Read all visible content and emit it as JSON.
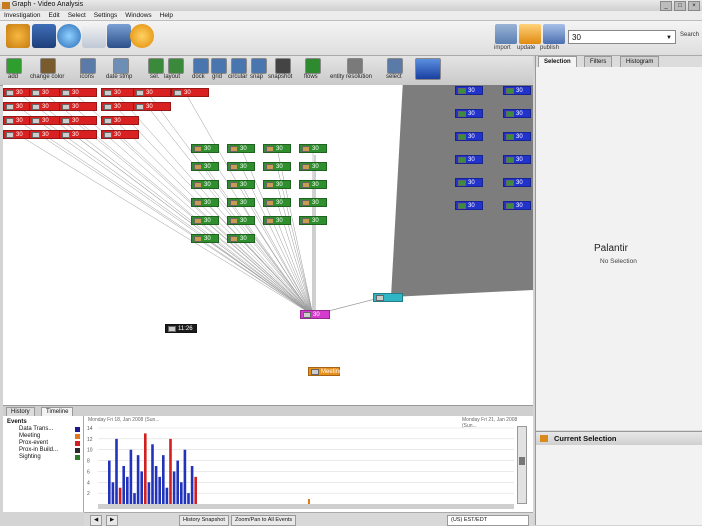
{
  "window": {
    "title": "Graph - Video Analysis"
  },
  "menu": [
    "Investigation",
    "Edit",
    "Select",
    "Settings",
    "Windows",
    "Help"
  ],
  "top_actions": [
    {
      "label": "import",
      "icon": "import-icon"
    },
    {
      "label": "update",
      "icon": "update-icon"
    },
    {
      "label": "publish",
      "icon": "publish-icon"
    }
  ],
  "search": {
    "value": "30",
    "button": "Search"
  },
  "tools": [
    {
      "label": "add",
      "icon": "add-icon",
      "color": "#2e9e2e"
    },
    {
      "label": "change color",
      "icon": "change-color-icon",
      "color": "#7a5b2e"
    },
    {
      "label": "icons",
      "icon": "icons-icon",
      "color": "#5a7aa8"
    },
    {
      "label": "date stmp",
      "icon": "date-stamp-icon",
      "color": "#6e8fb5"
    },
    {
      "label": "sel.",
      "icon": "select-icon",
      "color": "#3b8a3b"
    },
    {
      "label": "layout",
      "icon": "layout-icon",
      "color": "#3b8a3b"
    },
    {
      "label": "dock",
      "icon": "dock-icon",
      "color": "#4a76b0"
    },
    {
      "label": "grid",
      "icon": "grid-icon",
      "color": "#4a76b0"
    },
    {
      "label": "circular",
      "icon": "circular-icon",
      "color": "#4a76b0"
    },
    {
      "label": "snap",
      "icon": "snap-icon",
      "color": "#4a76b0"
    },
    {
      "label": "snapshot",
      "icon": "camera-icon",
      "color": "#444444"
    },
    {
      "label": "flows",
      "icon": "flows-icon",
      "color": "#2e8a2e"
    },
    {
      "label": "entity resolution",
      "icon": "entity-resolution-icon",
      "color": "#7a7a7a"
    },
    {
      "label": "select",
      "icon": "select-all-icon",
      "color": "#5a7aa8"
    }
  ],
  "node_label": "30",
  "edge_labels": {
    "time": "11:26",
    "meeting": "Meeting"
  },
  "bottom_tabs": [
    "History",
    "Timeline"
  ],
  "events_tree": {
    "root": "Events",
    "items": [
      {
        "label": "Data Trans...",
        "color": "#1a1a8a"
      },
      {
        "label": "Meeting",
        "color": "#e07a1a"
      },
      {
        "label": "Prox-event",
        "color": "#d22020"
      },
      {
        "label": "Prox-in Build...",
        "color": "#2a2a2a"
      },
      {
        "label": "Sighting",
        "color": "#2a7a2a"
      }
    ]
  },
  "timeline": {
    "y_ticks": [
      "14",
      "12",
      "10",
      "8",
      "6",
      "4",
      "2"
    ],
    "header_left": "Monday Fri 18, Jan 2008 (Sun...",
    "header_right": "Monday Fri 21, Jan 2008 (Sun..."
  },
  "status_buttons": [
    "History Snapshot",
    "Zoom/Pan to All Events"
  ],
  "timezone": "(US) EST/EDT",
  "right_tabs": [
    "Selection",
    "Filters",
    "Histogram"
  ],
  "right_panel": {
    "brand": "Palantir",
    "empty_text": "No Selection",
    "current_selection": "Current Selection"
  }
}
